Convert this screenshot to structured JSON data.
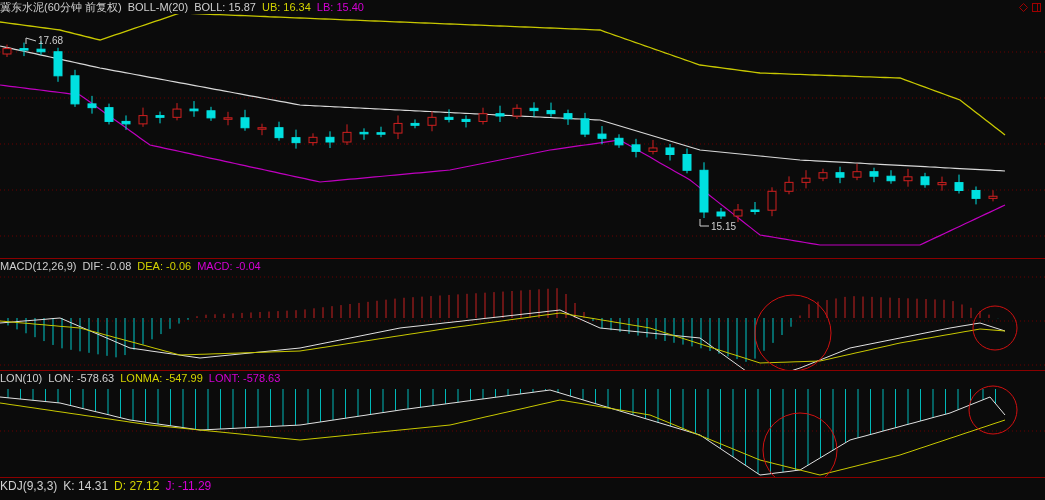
{
  "main_panel": {
    "title": "冀东水泥(60分钟 前复权)",
    "legend": [
      {
        "text": "BOLL-M(20)",
        "color": "#d0d0d0"
      },
      {
        "text": "BOLL: 15.87",
        "color": "#d0d0d0"
      },
      {
        "text": "UB: 16.34",
        "color": "#d4d400"
      },
      {
        "text": "LB: 15.40",
        "color": "#d400d4"
      }
    ],
    "high_label": "17.68",
    "low_label": "15.15"
  },
  "macd_panel": {
    "legend": [
      {
        "text": "MACD(12,26,9)",
        "color": "#d0d0d0"
      },
      {
        "text": "DIF: -0.08",
        "color": "#d0d0d0"
      },
      {
        "text": "DEA: -0.06",
        "color": "#d4d400"
      },
      {
        "text": "MACD: -0.04",
        "color": "#d400d4"
      }
    ]
  },
  "lon_panel": {
    "legend": [
      {
        "text": "LON(10)",
        "color": "#d0d0d0"
      },
      {
        "text": "LON: -578.63",
        "color": "#d0d0d0"
      },
      {
        "text": "LONMA: -547.99",
        "color": "#d4d400"
      },
      {
        "text": "LONT: -578.63",
        "color": "#d400d4"
      }
    ]
  },
  "kdj_panel": {
    "legend": [
      {
        "text": "KDJ(9,3,3)",
        "color": "#d0d0d0"
      },
      {
        "text": "K: 14.31",
        "color": "#d0d0d0"
      },
      {
        "text": "D: 27.12",
        "color": "#d4d400"
      },
      {
        "text": "J: -11.29",
        "color": "#d400d4"
      }
    ]
  }
}
